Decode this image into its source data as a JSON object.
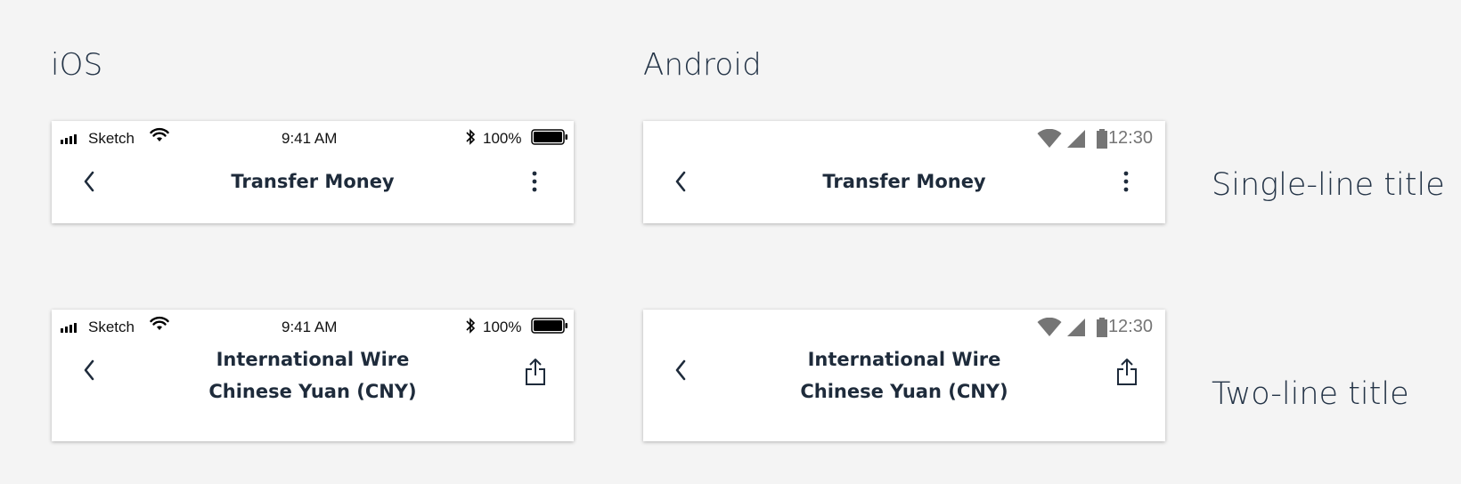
{
  "headings": {
    "ios": "iOS",
    "android": "Android"
  },
  "labels": {
    "single": "Single-line title",
    "double": "Two-line title"
  },
  "ios_status": {
    "carrier": "Sketch",
    "time": "9:41 AM",
    "battery_pct": "100%",
    "icons": [
      "signal-icon",
      "wifi-icon",
      "bluetooth-icon",
      "battery-icon"
    ]
  },
  "android_status": {
    "time": "12:30",
    "icons": [
      "wifi-icon",
      "cell-signal-icon",
      "battery-icon"
    ]
  },
  "screens": {
    "single": {
      "title": "Transfer Money",
      "left_icon": "back-chevron-icon",
      "right_icon": "more-vertical-icon"
    },
    "double": {
      "title_line1": "International Wire",
      "title_line2": "Chinese Yuan (CNY)",
      "left_icon": "back-chevron-icon",
      "right_icon": "share-icon"
    }
  },
  "colors": {
    "background": "#f4f4f4",
    "title_text": "#1e2b3b",
    "android_status_text": "#757575"
  }
}
